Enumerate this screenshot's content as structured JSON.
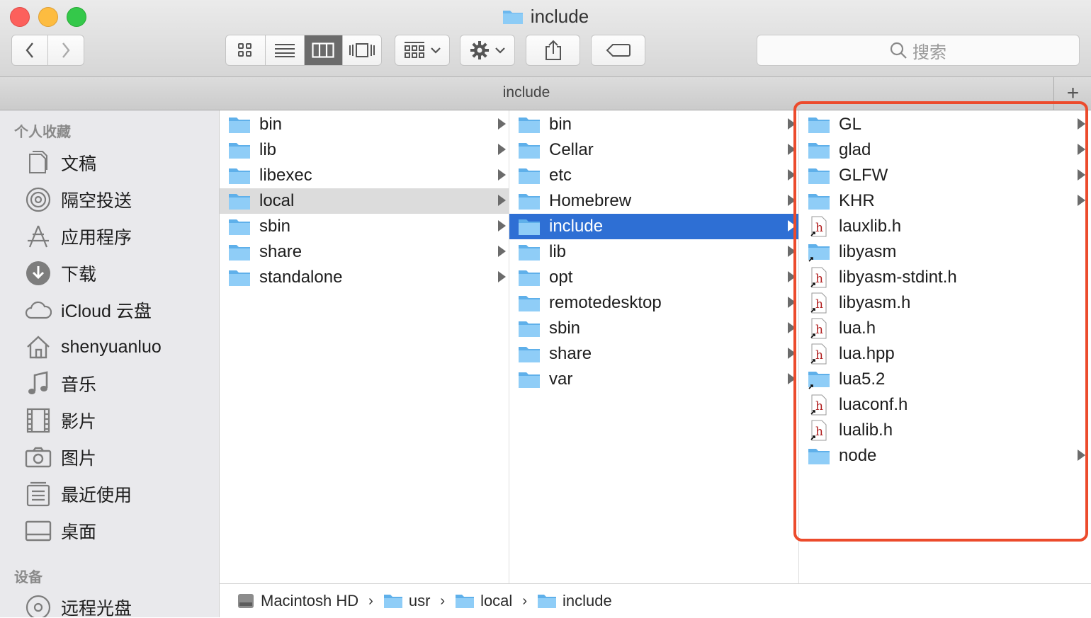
{
  "window": {
    "title": "include"
  },
  "toolbar": {
    "view_modes": [
      "icon-view",
      "list-view",
      "column-view",
      "cover-flow-view"
    ],
    "active_view": "column-view",
    "search_placeholder": "搜索"
  },
  "tabbar": {
    "label": "include",
    "add_tab": "+"
  },
  "sidebar": {
    "favorites_header": "个人收藏",
    "favorites": [
      {
        "label": "文稿",
        "icon": "documents-icon"
      },
      {
        "label": "隔空投送",
        "icon": "airdrop-icon"
      },
      {
        "label": "应用程序",
        "icon": "applications-icon"
      },
      {
        "label": "下载",
        "icon": "downloads-icon"
      },
      {
        "label": "iCloud 云盘",
        "icon": "icloud-icon"
      },
      {
        "label": "shenyuanluo",
        "icon": "home-icon"
      },
      {
        "label": "音乐",
        "icon": "music-icon"
      },
      {
        "label": "影片",
        "icon": "movies-icon"
      },
      {
        "label": "图片",
        "icon": "pictures-icon"
      },
      {
        "label": "最近使用",
        "icon": "recents-icon"
      },
      {
        "label": "桌面",
        "icon": "desktop-icon"
      }
    ],
    "devices_header": "设备",
    "devices": [
      {
        "label": "远程光盘",
        "icon": "remote-disc-icon"
      }
    ]
  },
  "columns": {
    "col1": [
      {
        "name": "bin",
        "type": "folder",
        "arrow": true
      },
      {
        "name": "lib",
        "type": "folder",
        "arrow": true
      },
      {
        "name": "libexec",
        "type": "folder",
        "arrow": true
      },
      {
        "name": "local",
        "type": "folder",
        "arrow": true,
        "state": "selected-inactive"
      },
      {
        "name": "sbin",
        "type": "folder",
        "arrow": true
      },
      {
        "name": "share",
        "type": "folder",
        "arrow": true
      },
      {
        "name": "standalone",
        "type": "folder",
        "arrow": true
      }
    ],
    "col2": [
      {
        "name": "bin",
        "type": "folder",
        "arrow": true
      },
      {
        "name": "Cellar",
        "type": "folder",
        "arrow": true
      },
      {
        "name": "etc",
        "type": "folder",
        "arrow": true
      },
      {
        "name": "Homebrew",
        "type": "folder",
        "arrow": true
      },
      {
        "name": "include",
        "type": "folder",
        "arrow": true,
        "state": "selected-active"
      },
      {
        "name": "lib",
        "type": "folder",
        "arrow": true
      },
      {
        "name": "opt",
        "type": "folder",
        "arrow": true
      },
      {
        "name": "remotedesktop",
        "type": "folder",
        "arrow": true
      },
      {
        "name": "sbin",
        "type": "folder",
        "arrow": true
      },
      {
        "name": "share",
        "type": "folder",
        "arrow": true
      },
      {
        "name": "var",
        "type": "folder",
        "arrow": true
      }
    ],
    "col3": [
      {
        "name": "GL",
        "type": "folder",
        "arrow": true
      },
      {
        "name": "glad",
        "type": "folder",
        "arrow": true
      },
      {
        "name": "GLFW",
        "type": "folder",
        "arrow": true
      },
      {
        "name": "KHR",
        "type": "folder",
        "arrow": true
      },
      {
        "name": "lauxlib.h",
        "type": "header-alias",
        "arrow": false
      },
      {
        "name": "libyasm",
        "type": "folder-alias",
        "arrow": false
      },
      {
        "name": "libyasm-stdint.h",
        "type": "header-alias",
        "arrow": false
      },
      {
        "name": "libyasm.h",
        "type": "header-alias",
        "arrow": false
      },
      {
        "name": "lua.h",
        "type": "header-alias",
        "arrow": false
      },
      {
        "name": "lua.hpp",
        "type": "header-alias",
        "arrow": false
      },
      {
        "name": "lua5.2",
        "type": "folder-alias",
        "arrow": false
      },
      {
        "name": "luaconf.h",
        "type": "header-alias",
        "arrow": false
      },
      {
        "name": "lualib.h",
        "type": "header-alias",
        "arrow": false
      },
      {
        "name": "node",
        "type": "folder",
        "arrow": true
      }
    ]
  },
  "pathbar": [
    {
      "label": "Macintosh HD",
      "icon": "hard-drive-icon"
    },
    {
      "label": "usr",
      "icon": "folder-icon"
    },
    {
      "label": "local",
      "icon": "folder-icon"
    },
    {
      "label": "include",
      "icon": "folder-icon"
    }
  ],
  "colors": {
    "selection_blue": "#2e6fd4",
    "folder_blue": "#6cb8ee",
    "highlight_box": "#ec4b2c"
  }
}
